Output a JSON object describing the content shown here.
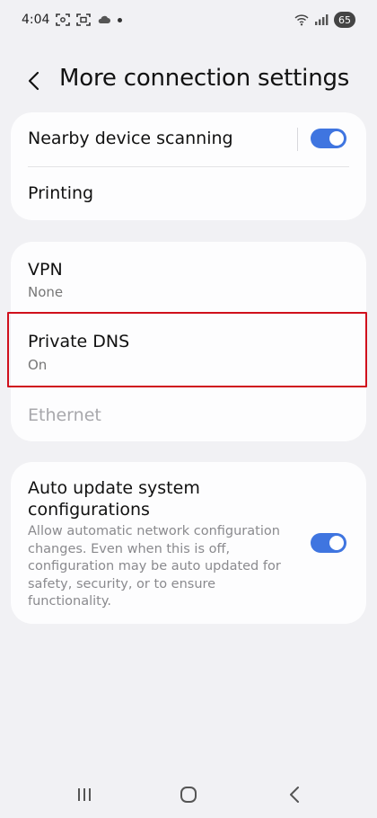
{
  "status": {
    "time": "4:04",
    "battery": "65"
  },
  "header": {
    "title": "More connection settings"
  },
  "card1": {
    "nearby": {
      "label": "Nearby device scanning",
      "enabled": true
    },
    "printing": {
      "label": "Printing"
    }
  },
  "card2": {
    "vpn": {
      "label": "VPN",
      "value": "None"
    },
    "private_dns": {
      "label": "Private DNS",
      "value": "On"
    },
    "ethernet": {
      "label": "Ethernet"
    }
  },
  "card3": {
    "auto_update": {
      "label_line1": "Auto update system",
      "label_line2": "configurations",
      "description": "Allow automatic network configuration changes. Even when this is off, configuration may be auto updated for safety, security, or to ensure functionality.",
      "enabled": true
    }
  },
  "colors": {
    "accent": "#3f75e0",
    "highlight": "#d0101c",
    "background": "#f1f1f4",
    "card": "#fdfdfe"
  },
  "icons": {
    "status_left": [
      "screenshot-icon",
      "screen-record-icon",
      "cloud-icon",
      "notification-dot-icon"
    ],
    "status_right": [
      "wifi-icon",
      "signal-icon",
      "battery-icon"
    ],
    "nav": [
      "recents-icon",
      "home-icon",
      "back-nav-icon"
    ]
  }
}
